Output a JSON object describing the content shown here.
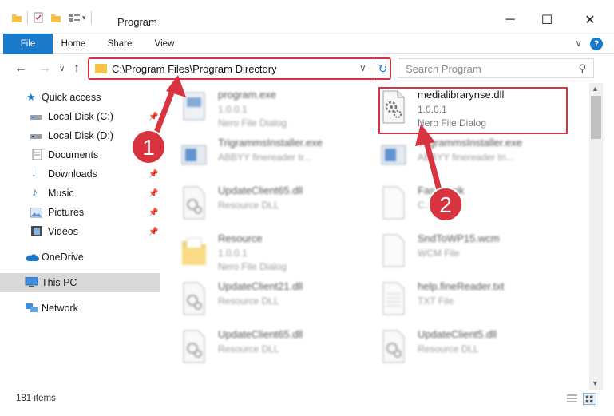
{
  "window": {
    "title": "Program",
    "minimize_glyph": "─",
    "maximize_glyph": "☐",
    "close_glyph": "✕"
  },
  "ribbon": {
    "tabs": [
      "File",
      "Home",
      "Share",
      "View"
    ],
    "help": "?"
  },
  "address": {
    "path": "C:\\Program Files\\Program Directory",
    "search_placeholder": "Search Program"
  },
  "navpane": {
    "items": [
      {
        "label": "Quick access",
        "icon": "star-icon"
      },
      {
        "label": "Local Disk (C:)",
        "icon": "drive-icon"
      },
      {
        "label": "Local Disk (D:)",
        "icon": "drive-icon"
      },
      {
        "label": "Documents",
        "icon": "documents-icon"
      },
      {
        "label": "Downloads",
        "icon": "downloads-icon"
      },
      {
        "label": "Music",
        "icon": "music-icon"
      },
      {
        "label": "Pictures",
        "icon": "pictures-icon"
      },
      {
        "label": "Videos",
        "icon": "videos-icon"
      },
      {
        "label": "OneDrive",
        "icon": "cloud-icon"
      },
      {
        "label": "This PC",
        "icon": "computer-icon"
      },
      {
        "label": "Network",
        "icon": "network-icon"
      }
    ]
  },
  "files": {
    "left": [
      {
        "name": "program.exe",
        "line2": "1.0.0.1",
        "line3": "Nero File Dialog",
        "icon": "exe-icon"
      },
      {
        "name": "TrigrammsInstaller.exe",
        "line2": "ABBYY finereader tr...",
        "line3": "",
        "icon": "installer-icon"
      },
      {
        "name": "UpdateClient65.dll",
        "line2": "Resource DLL",
        "line3": "",
        "icon": "dll-icon"
      },
      {
        "name": "Resource",
        "line2": "1.0.0.1",
        "line3": "Nero File Dialog",
        "icon": "folder-icon"
      },
      {
        "name": "UpdateClient21.dll",
        "line2": "Resource DLL",
        "line3": "",
        "icon": "dll-icon"
      },
      {
        "name": "UpdateClient65.dll",
        "line2": "Resource DLL",
        "line3": "",
        "icon": "dll-icon"
      }
    ],
    "right": [
      {
        "name": "medialibrarynse.dll",
        "line2": "1.0.0.1",
        "line3": "Nero File Dialog",
        "icon": "dll-icon"
      },
      {
        "name": "TrigrammsInstaller.exe",
        "line2": "ABBYY finereader tri...",
        "line3": "",
        "icon": "installer-icon"
      },
      {
        "name": "Fas...s.cjk",
        "line2": "C...",
        "line3": "",
        "icon": "file-icon"
      },
      {
        "name": "SndToWP15.wcm",
        "line2": "WCM File",
        "line3": "",
        "icon": "file-icon"
      },
      {
        "name": "help.fineReader.txt",
        "line2": "TXT File",
        "line3": "",
        "icon": "text-file-icon"
      },
      {
        "name": "UpdateClient5.dll",
        "line2": "Resource DLL",
        "line3": "",
        "icon": "dll-icon"
      }
    ]
  },
  "annotations": {
    "marker1": "1",
    "marker2": "2",
    "color": "#d9333f"
  },
  "status": {
    "item_count": "181 items"
  },
  "colors": {
    "accent": "#1979ca",
    "highlight": "#d9333f",
    "folder": "#f3c345"
  }
}
